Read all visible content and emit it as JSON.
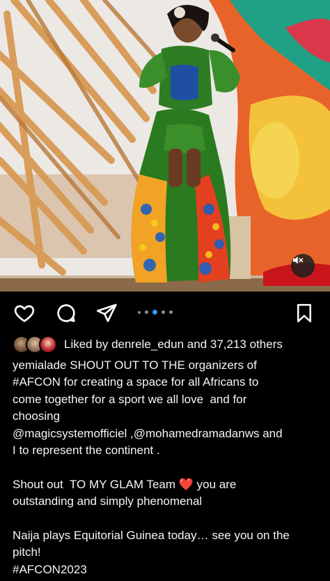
{
  "post": {
    "media_muted": true,
    "carousel": {
      "count": 5,
      "active_index": 3
    },
    "likes": {
      "prefix": "Liked by",
      "user": "denrele_edun",
      "connector": "and",
      "others": "37,213 others"
    },
    "caption": {
      "username": "yemialade",
      "lines": [
        "SHOUT OUT TO THE organizers of",
        "#AFCON for creating a space for all Africans to",
        "come together for a sport we all love  and for",
        "choosing",
        "@magicsystemofficiel ,@mohamedramadanws and",
        "I to represent the continent .",
        "",
        "Shout out  TO MY GLAM Team ❤️ you are",
        "outstanding and simply phenomenal",
        "",
        "Naija plays Equitorial Guinea today… see you on the",
        "pitch!",
        "#AFCON2023"
      ]
    }
  },
  "icons": {
    "like": "heart-icon",
    "comment": "comment-icon",
    "share": "send-icon",
    "save": "bookmark-icon",
    "mute": "speaker-muted-icon"
  },
  "colors": {
    "background": "#000000",
    "text": "#f5f5f5",
    "carousel_active": "#3897f0",
    "carousel_inactive": "#8e8e8e"
  }
}
